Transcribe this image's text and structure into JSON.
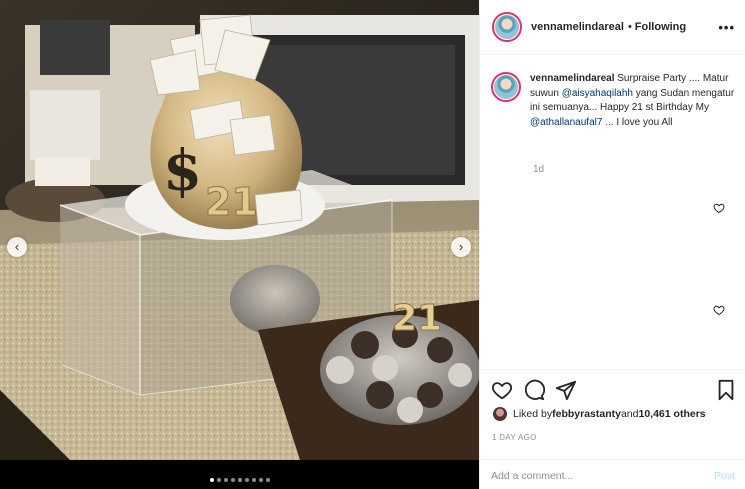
{
  "post": {
    "username": "vennamelindareal",
    "separator": "•",
    "follow_status": "Following",
    "more_icon": "•••"
  },
  "media": {
    "prev_icon": "‹",
    "next_icon": "›",
    "slides_count": 9,
    "active_slide": 1
  },
  "caption": {
    "username": "vennamelindareal",
    "text_1": " Surpraise Party .... Matur suwun ",
    "mention_1": "@aisyahaqilahh",
    "text_2": " yang Sudan mengatur ini semuanya... Happy 21 st Birthday My ",
    "mention_2": "@athallanaufal7",
    "text_3": " ... I love you All",
    "time": "1d"
  },
  "likes": {
    "prefix": "Liked by ",
    "user": "febbyrastanty",
    "middle": " and ",
    "count": "10,461 others"
  },
  "date": "1 DAY AGO",
  "comment": {
    "placeholder": "Add a comment...",
    "post_label": "Post"
  },
  "colors": {
    "link": "#00376b",
    "muted": "#8e8e8e",
    "post_disabled": "#b2dffc",
    "story_ring": "#e1306c"
  }
}
